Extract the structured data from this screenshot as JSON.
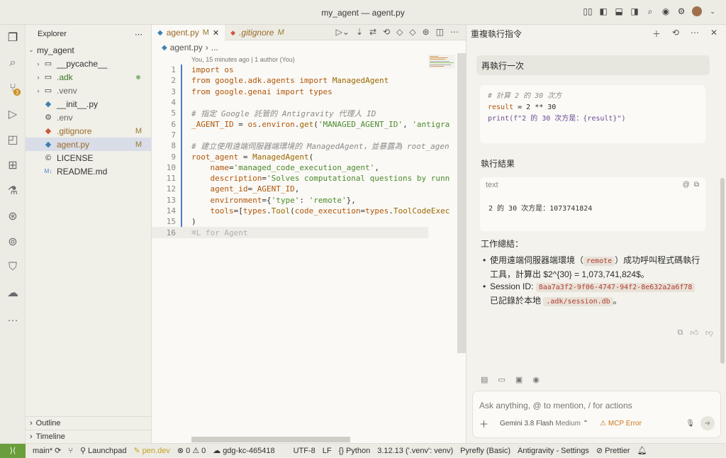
{
  "window": {
    "title": "my_agent — agent.py"
  },
  "sidebar": {
    "title": "Explorer",
    "root": "my_agent",
    "items": [
      {
        "label": "__pycache__",
        "type": "folder"
      },
      {
        "label": ".adk",
        "type": "folder"
      },
      {
        "label": ".venv",
        "type": "folder"
      },
      {
        "label": "__init__.py",
        "type": "py"
      },
      {
        "label": ".env",
        "type": "gear"
      },
      {
        "label": ".gitignore",
        "type": "git",
        "badge": "M"
      },
      {
        "label": "agent.py",
        "type": "py",
        "badge": "M"
      },
      {
        "label": "LICENSE",
        "type": "license"
      },
      {
        "label": "README.md",
        "type": "md"
      }
    ],
    "outline": "Outline",
    "timeline": "Timeline"
  },
  "editor": {
    "tabs": [
      {
        "label": "agent.py",
        "badge": "M"
      },
      {
        "label": ".gitignore",
        "badge": "M"
      }
    ],
    "breadcrumb": "agent.py",
    "breadcrumb_more": "...",
    "blame": "You, 15 minutes ago | 1 author (You)",
    "ghost_hint": "⌘L for Agent"
  },
  "agent": {
    "title": "重複執行指令",
    "user_message": "再執行一次",
    "code": {
      "comment": "# 計算 2 的 30 次方",
      "line2_var": "result",
      "line2_rest": " = 2 ** 30",
      "line3": "print(f\"2 的 30 次方是：{result}\")"
    },
    "result_title": "執行結果",
    "result_label": "text",
    "result_output": "2 的 30 次方是：1073741824",
    "summary_title": "工作總結：",
    "bullet1_a": "使用遠端伺服器端環境（",
    "bullet1_chip": "remote",
    "bullet1_b": "）成功呼叫程式碼執行工具，計算出 $2^{30} = 1,073,741,824$。",
    "bullet2_a": "Session ID:",
    "bullet2_chip": "8aa7a3f2-9f06-4747-94f2-8e632a2a6f78",
    "bullet2_b": "已記錄於本地",
    "bullet2_chip2": ".adk/session.db",
    "bullet2_c": "。",
    "input_placeholder": "Ask anything, @ to mention, / for actions",
    "model": "Gemini 3.8 Flash",
    "model_mode": "Medium",
    "mcp_error": "MCP Error"
  },
  "status": {
    "branch": "main*",
    "launchpad": "Launchpad",
    "pen": "pen.dev",
    "errors": "0",
    "warnings": "0",
    "project": "gdg-kc-465418",
    "encoding": "UTF-8",
    "eol": "LF",
    "language": "Python",
    "interpreter": "3.12.13 ('.venv': venv)",
    "pyrefly": "Pyrefly (Basic)",
    "antigravity": "Antigravity - Settings",
    "prettier": "Prettier"
  },
  "colors": {
    "accent": "#4a7bd0",
    "remote": "#6a9d3b",
    "warning": "#c9771c"
  }
}
